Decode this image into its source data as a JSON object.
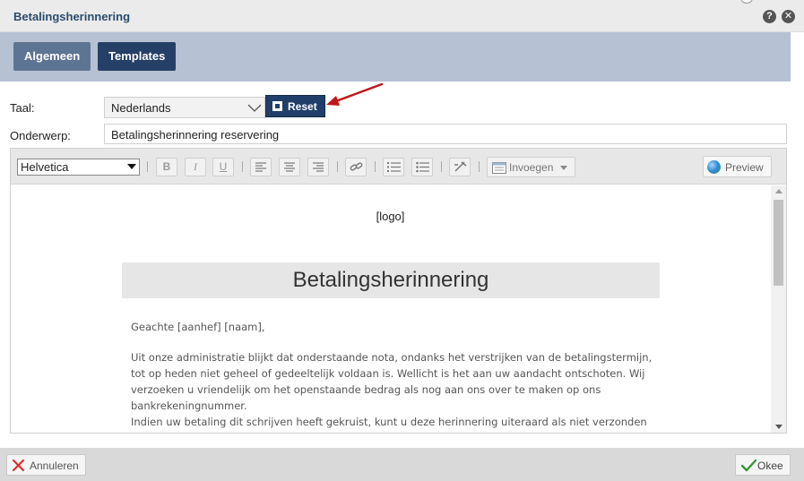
{
  "dialog": {
    "title": "Betalingsherinnering",
    "help_icon": "?",
    "close_icon": "✕"
  },
  "tabs": [
    {
      "label": "Algemeen",
      "active": false
    },
    {
      "label": "Templates",
      "active": true
    }
  ],
  "form": {
    "language_label": "Taal:",
    "language_value": "Nederlands",
    "reset_label": "Reset",
    "subject_label": "Onderwerp:",
    "subject_value": "Betalingsherinnering reservering"
  },
  "toolbar": {
    "font_value": "Helvetica",
    "bold": "B",
    "italic": "I",
    "underline": "U",
    "insert_label": "Invoegen",
    "preview_label": "Preview"
  },
  "document": {
    "logo_placeholder": "[logo]",
    "heading": "Betalingsherinnering",
    "greeting": "Geachte [aanhef] [naam],",
    "body_1": "Uit onze administratie blijkt dat onderstaande nota, ondanks het verstrijken van de betalingstermijn, tot op heden niet geheel of gedeeltelijk voldaan is. Wellicht is het aan uw aandacht ontschoten. Wij verzoeken u vriendelijk om het openstaande bedrag als nog aan ons over te maken op ons bankrekeningnummer.",
    "body_2": "Indien uw betaling dit schrijven heeft gekruist, kunt u deze herinnering uiteraard als niet verzonden"
  },
  "footer": {
    "cancel_label": "Annuleren",
    "ok_label": "Okee"
  },
  "colors": {
    "title_text": "#2b4a6f",
    "tab_band": "#b6c1d3",
    "tab_active": "#263f66",
    "tab_inactive": "#5d7593",
    "reset_button": "#213e6a",
    "annotation_arrow": "#c0161b"
  }
}
